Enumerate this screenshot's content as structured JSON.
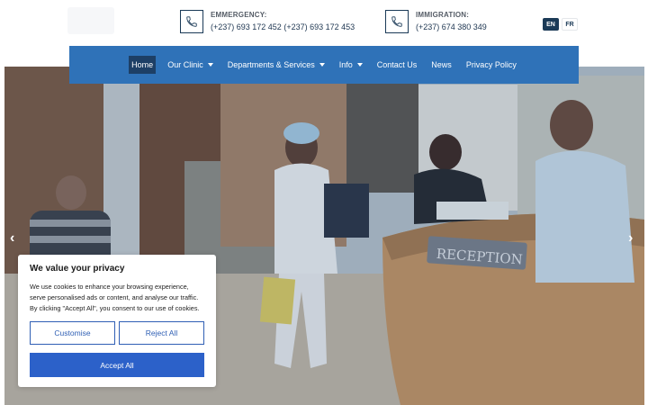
{
  "header": {
    "emergency": {
      "label": "EMMERGENCY:",
      "number": "(+237) 693 172 452 (+237) 693 172 453",
      "icon": "phone-icon"
    },
    "immigration": {
      "label": "IMMIGRATION:",
      "number": "(+237) 674 380 349",
      "icon": "phone-icon"
    },
    "languages": [
      "EN",
      "FR"
    ],
    "active_language": "EN"
  },
  "nav": {
    "items": [
      {
        "label": "Home",
        "active": true,
        "dropdown": false
      },
      {
        "label": "Our Clinic",
        "active": false,
        "dropdown": true
      },
      {
        "label": "Departments & Services",
        "active": false,
        "dropdown": true
      },
      {
        "label": "Info",
        "active": false,
        "dropdown": true
      },
      {
        "label": "Contact Us",
        "active": false,
        "dropdown": false
      },
      {
        "label": "News",
        "active": false,
        "dropdown": false
      },
      {
        "label": "Privacy Policy",
        "active": false,
        "dropdown": false
      }
    ]
  },
  "hero": {
    "sign_text": "RECEPTION",
    "prev_icon": "chevron-left-icon",
    "next_icon": "chevron-right-icon",
    "prev_glyph": "‹",
    "next_glyph": "›"
  },
  "cookie": {
    "title": "We value your privacy",
    "text": "We use cookies to enhance your browsing experience, serve personalised ads or content, and analyse our traffic. By clicking \"Accept All\", you consent to our use of cookies.",
    "customise": "Customise",
    "reject": "Reject All",
    "accept": "Accept All"
  },
  "colors": {
    "nav_bg": "#2f72b8",
    "nav_active": "#1d3f66",
    "accept_bg": "#2c61c9",
    "dark_blue": "#1b3a57"
  }
}
